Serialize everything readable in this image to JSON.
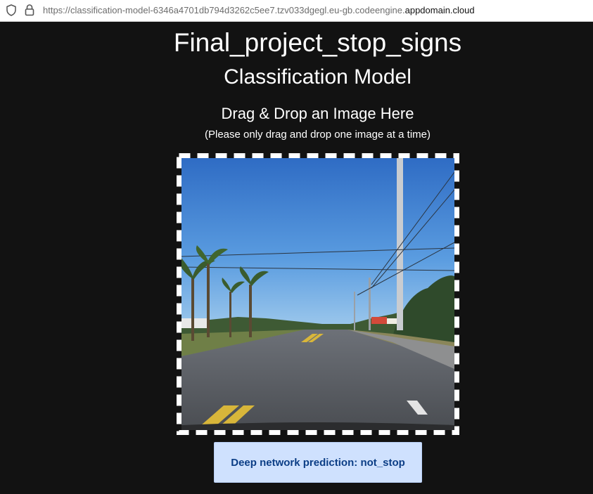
{
  "browser": {
    "url_prefix": "https://classification-model-6346a4701db794d3262c5ee7.tzv033dgegl.eu-gb.codeengine.",
    "url_domain": "appdomain.cloud"
  },
  "page": {
    "title": "Final_project_stop_signs",
    "subtitle": "Classification Model",
    "drop_heading": "Drag & Drop an Image Here",
    "drop_note": "(Please only drag and drop one image at a time)"
  },
  "prediction": {
    "label": "Deep network prediction:",
    "value": "not_stop"
  },
  "colors": {
    "page_background": "#121212",
    "prediction_background": "#cfe1fe",
    "prediction_text": "#0c3e86"
  },
  "icons": [
    "shield-icon",
    "lock-icon"
  ]
}
